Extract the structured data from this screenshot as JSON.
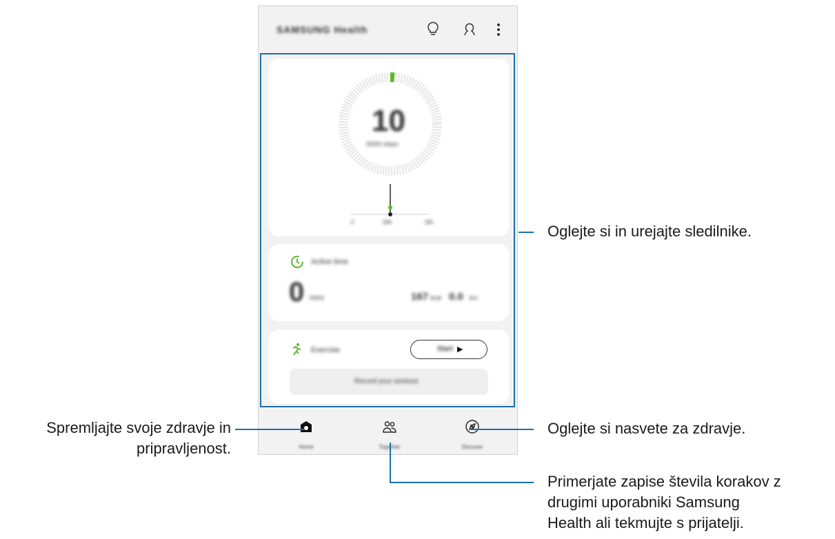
{
  "app": {
    "title": "SAMSUNG Health",
    "header_icons": [
      "lightbulb-icon",
      "person-icon",
      "more-options-icon"
    ]
  },
  "steps_card": {
    "count": "10",
    "subtitle": "/6000 steps",
    "timeline_labels": [
      "0",
      "06h",
      "18h"
    ]
  },
  "active_card": {
    "title": "Active time",
    "minutes": "0",
    "minutes_unit": "mins",
    "calories": "167",
    "calories_unit": "kcal",
    "distance": "0.0",
    "distance_unit": "km"
  },
  "exercise_card": {
    "title": "Exercise",
    "start_label": "Start",
    "record_label": "Record your workout"
  },
  "nav": {
    "home": "Home",
    "together": "Together",
    "discover": "Discover"
  },
  "callouts": {
    "trackers": "Oglejte si in urejajte sledilnike.",
    "health_line1": "Spremljajte svoje zdravje in",
    "health_line2": "pripravljenost.",
    "tips": "Oglejte si nasvete za zdravje.",
    "compare_line1": "Primerjate zapise števila korakov z",
    "compare_line2": "drugimi uporabniki Samsung",
    "compare_line3": "Health ali tekmujte s prijatelji."
  },
  "colors": {
    "accent": "#1b6fa8",
    "progress_green": "#5cb82e",
    "card_bg": "#ffffff",
    "screen_bg": "#f2f2f2"
  },
  "steps_progress": 0.01
}
